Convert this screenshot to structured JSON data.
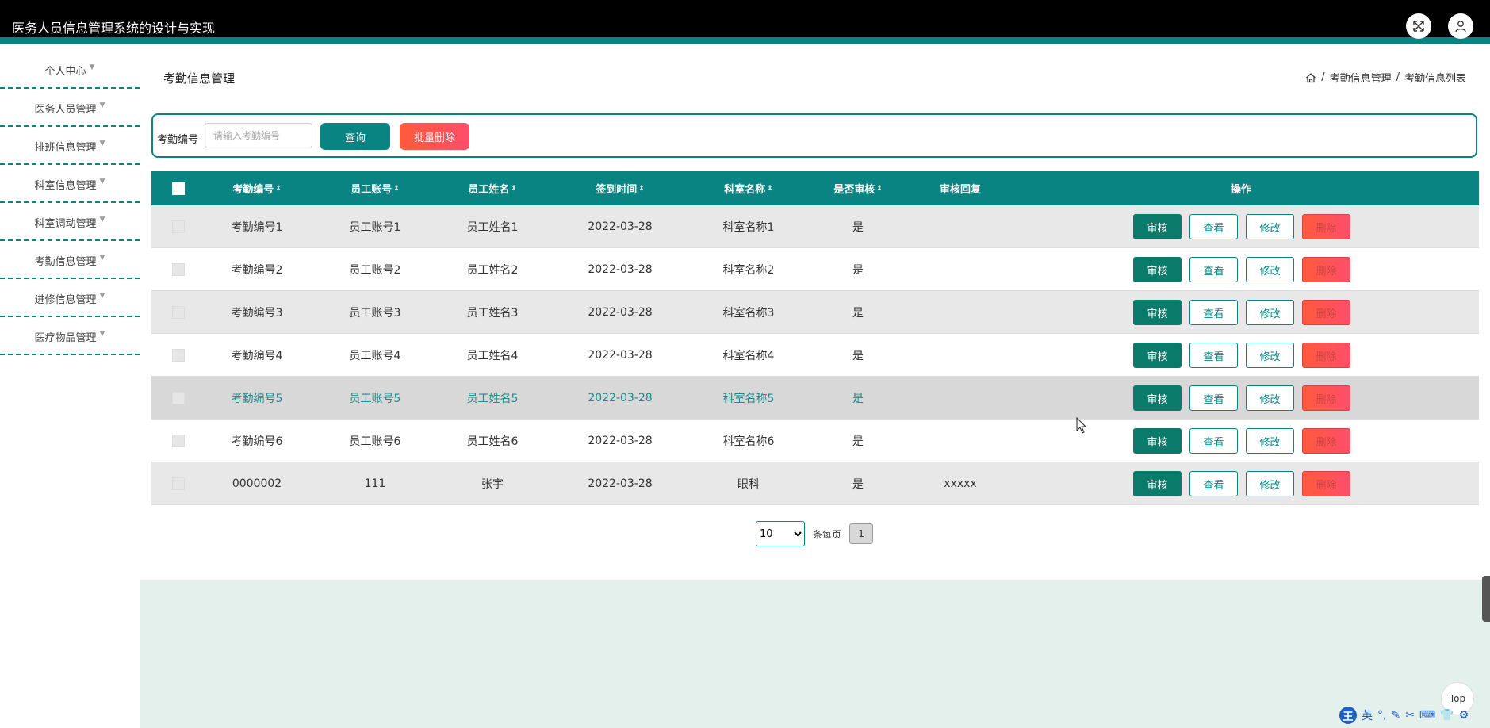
{
  "app": {
    "title": "医务人员信息管理系统的设计与实现"
  },
  "sidebar": {
    "items": [
      {
        "label": "个人中心"
      },
      {
        "label": "医务人员管理"
      },
      {
        "label": "排班信息管理"
      },
      {
        "label": "科室信息管理"
      },
      {
        "label": "科室调动管理"
      },
      {
        "label": "考勤信息管理"
      },
      {
        "label": "进修信息管理"
      },
      {
        "label": "医疗物品管理"
      }
    ]
  },
  "page": {
    "title": "考勤信息管理",
    "breadcrumb": [
      "考勤信息管理",
      "考勤信息列表"
    ],
    "breadcrumb_sep": "/"
  },
  "search": {
    "label": "考勤编号",
    "placeholder": "请输入考勤编号",
    "query_label": "查询",
    "batch_delete_label": "批量删除"
  },
  "table": {
    "headers": [
      "考勤编号",
      "员工账号",
      "员工姓名",
      "签到时间",
      "科室名称",
      "是否审核",
      "审核回复",
      "操作"
    ],
    "sort_icon": "⇕",
    "rows": [
      [
        "考勤编号1",
        "员工账号1",
        "员工姓名1",
        "2022-03-28",
        "科室名称1",
        "是",
        ""
      ],
      [
        "考勤编号2",
        "员工账号2",
        "员工姓名2",
        "2022-03-28",
        "科室名称2",
        "是",
        ""
      ],
      [
        "考勤编号3",
        "员工账号3",
        "员工姓名3",
        "2022-03-28",
        "科室名称3",
        "是",
        ""
      ],
      [
        "考勤编号4",
        "员工账号4",
        "员工姓名4",
        "2022-03-28",
        "科室名称4",
        "是",
        ""
      ],
      [
        "考勤编号5",
        "员工账号5",
        "员工姓名5",
        "2022-03-28",
        "科室名称5",
        "是",
        ""
      ],
      [
        "考勤编号6",
        "员工账号6",
        "员工姓名6",
        "2022-03-28",
        "科室名称6",
        "是",
        ""
      ],
      [
        "0000002",
        "111",
        "张宇",
        "2022-03-28",
        "眼科",
        "是",
        "xxxxx"
      ]
    ],
    "actions": {
      "audit": "审核",
      "view": "查看",
      "edit": "修改",
      "delete": "删除"
    }
  },
  "pagination": {
    "page_size": "10",
    "per_page_label": "条每页",
    "current_page": "1"
  },
  "misc": {
    "top_label": "Top",
    "ime_logo": "王",
    "ime_lang": "英"
  },
  "colors": {
    "primary": "#0a8383",
    "danger": "#ff5a3c",
    "header_bg": "#000000",
    "footer_bg": "#e3f0ec"
  }
}
